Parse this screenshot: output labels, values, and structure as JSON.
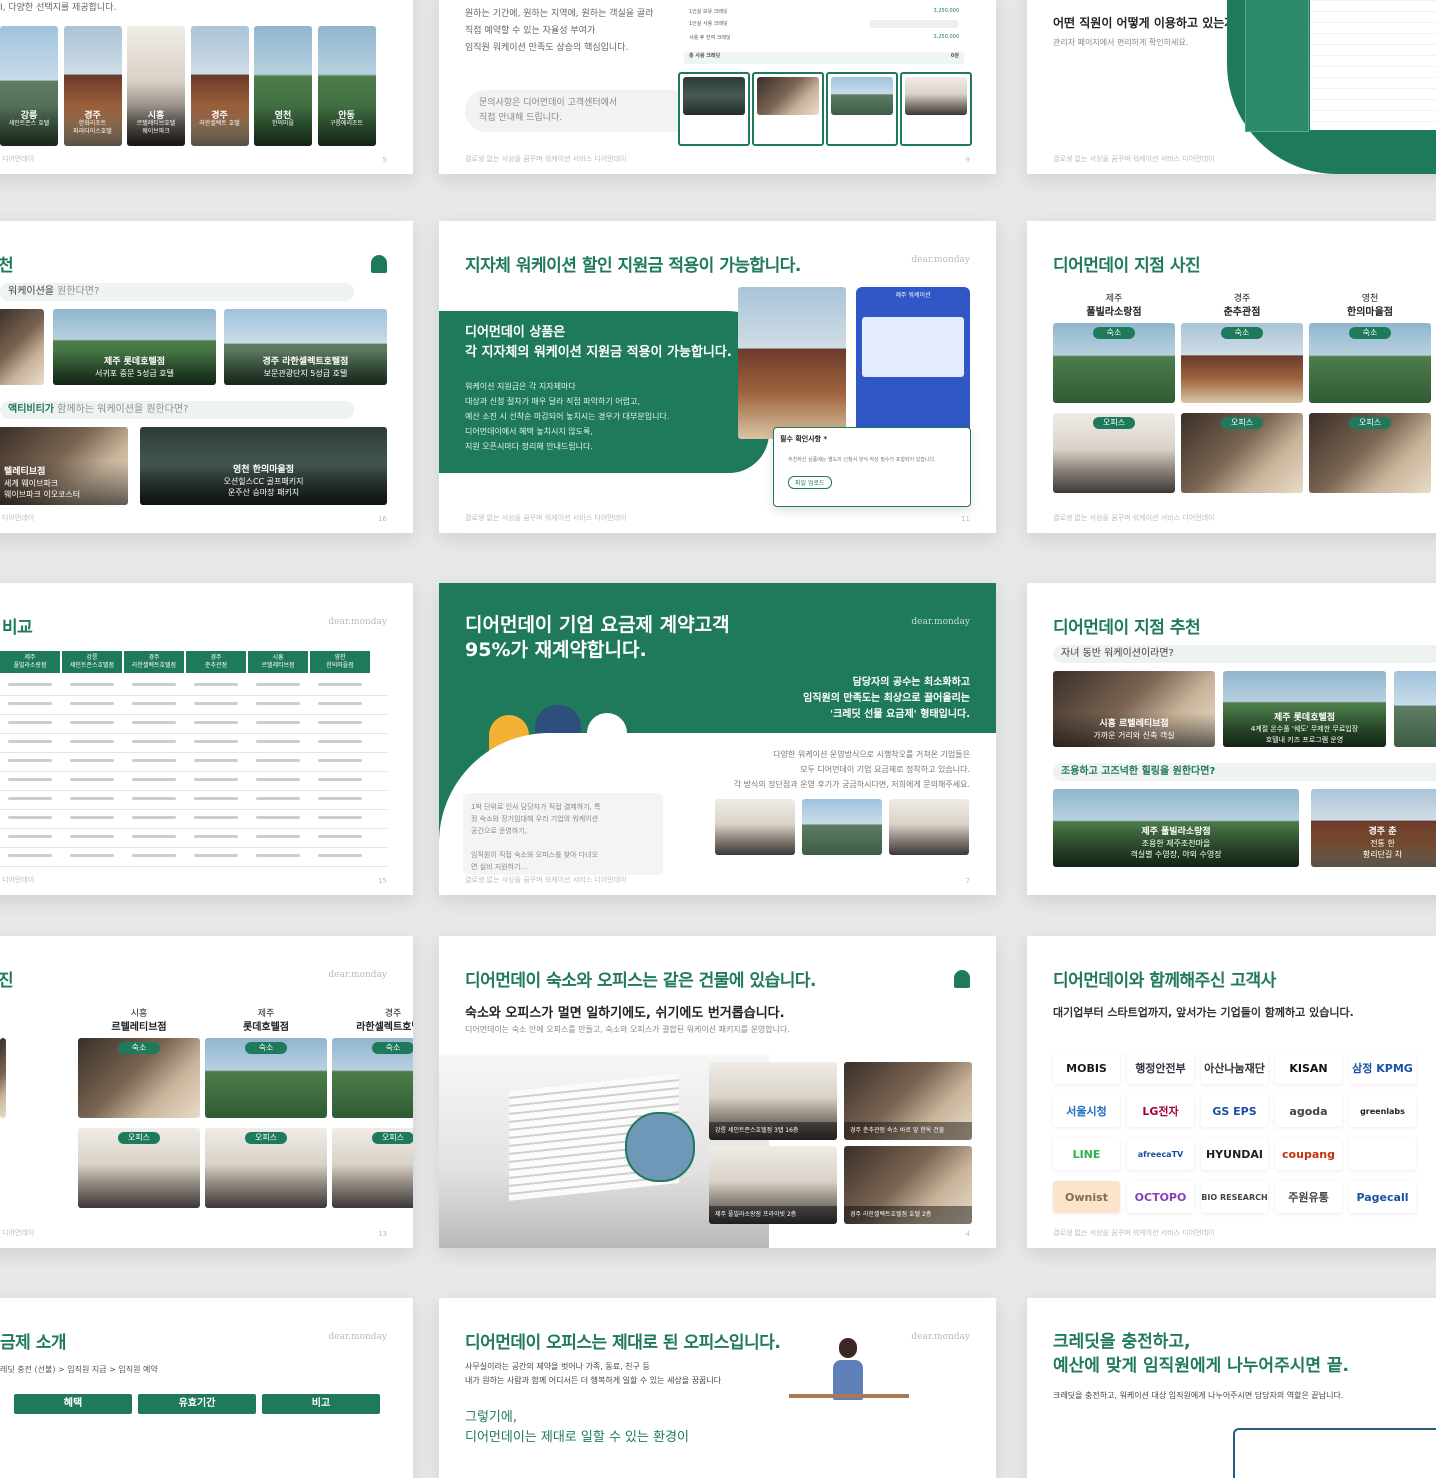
{
  "footer_text": "결로생 없는 서상을 꿈꾸며 워케이션 서비스 디어먼데이",
  "brand": "dear.monday",
  "s5": {
    "top_text": "I, 다양한 선택지를 제공합니다.",
    "cards": [
      {
        "name": "강릉",
        "sub": "세인트존스 호텔"
      },
      {
        "name": "경주",
        "sub": "한화리조트\n파라다이스호텔"
      },
      {
        "name": "시흥",
        "sub": "르텔레티브호텔\n웨이브파크"
      },
      {
        "name": "경주",
        "sub": "라한셀렉트 호텔"
      },
      {
        "name": "영천",
        "sub": "한의마을"
      },
      {
        "name": "안동",
        "sub": "구름에리조트"
      }
    ],
    "foot": "디어먼데이",
    "page": "5"
  },
  "s9": {
    "lines": [
      "원하는 기간에, 원하는 지역에, 원하는 객실을 골라",
      "직접 예약할 수 있는 자율성 부여가",
      "임직원 워케이션 만족도 상승의 핵심입니다."
    ],
    "pill": "문의사항은 디어먼데이 고객센터에서\n직접 안내해 드립니다.",
    "rows": [
      {
        "label": "1인실 보유 크레딧",
        "value": "3,250,000"
      },
      {
        "label": "1인실 사용 크레딧",
        "value": ""
      },
      {
        "label": "사용 후 잔여 크레딧",
        "value": "3,250,000"
      }
    ],
    "total_label": "총 사용 크레딧",
    "total_value": "0원",
    "page": "9"
  },
  "s_admin": {
    "lines": [
      "어떤 직원이 어떻게 이용하고 있는지,",
      "관리자 페이지에서 편리하게 확인하세요."
    ],
    "page_label": "결로생 없는 서상을 꿈꾸며 워케이션 서비스 디어먼데이"
  },
  "s16": {
    "title_fragment": "천",
    "q1_pre": "워케이션을",
    "q1_accent": " 원한다면?",
    "card_a": {
      "name": "제주 롯데호텔점",
      "sub": "서귀포 중문 5성급 호텔"
    },
    "card_b": {
      "name": "경주 라한셀렉트호텔점",
      "sub": "보문관광단지 5성급 호텔"
    },
    "q2_pre": "액티비티가",
    "q2_accent": " 함께하는 워케이션을 원한다면?",
    "card_c": {
      "name": "텔레티브점",
      "sub": "세계 웨이브파크\n웨이브파크 이오코스터"
    },
    "card_d": {
      "name": "영천 한의마을점",
      "sub": "오션힐스CC 골프패키지\n운주산 승마장 패키지"
    },
    "foot": "디어먼데이",
    "page": "16"
  },
  "s11": {
    "title": "지자체 워케이션 할인 지원금 적용이 가능합니다.",
    "box_title": "디어먼데이 상품은\n각 지자체의 워케이션 지원금 적용이 가능합니다.",
    "box_body": "워케이션 지원금은 각 지자체마다\n대상과 신청 절차가 매우 달라 직접 파악하기 어렵고,\n예산 소진 시 선착순 마감되어 놓치시는 경우가 대부분입니다.\n디어먼데이에서 혜택 놓치시지 않도록,\n지원 오픈시마다 정리해 안내드립니다.",
    "phone_header": "제주 워케이션",
    "dialog_title": "필수 확인사항 *",
    "dialog_body": "추천하신 상품에는 별도의 신청서 양식 작성 필수가 포함되어 있습니다.",
    "upload": "파일 업로드",
    "page": "11"
  },
  "s_photos": {
    "title": "디어먼데이 지점 사진",
    "cols": [
      {
        "region": "제주",
        "name": "풀빌라소랑점"
      },
      {
        "region": "경주",
        "name": "춘추관점"
      },
      {
        "region": "영천",
        "name": "한의마을점"
      }
    ],
    "lodging": "숙소",
    "office": "오피스"
  },
  "s15": {
    "title": "비교",
    "headers": [
      "제주\n풀빌라소랑점",
      "강릉\n세인트존스호텔점",
      "경주\n라한셀렉트호텔점",
      "경주\n춘추관점",
      "시흥\n르텔레티브점",
      "영천\n한의마을점"
    ],
    "foot": "디어먼데이",
    "page": "15"
  },
  "s7": {
    "title": "디어먼데이 기업 요금제 계약고객\n95%가 재계약합니다.",
    "right_text": "담당자의 공수는 최소화하고\n임직원의 만족도는 최상으로 끌어올리는\n'크레딧 선물 요금제' 형태입니다.",
    "desc": "다양한 워케이션 운영방식으로 시행착오를 거쳐온 기업들은\n모두 디어먼데이 기업 요금제로 정착하고 있습니다.\n각 방식의 장단점과 운영 후기가 궁금하시다면, 저희에게 문의해주세요.",
    "quote": "1박 단위로 인사 담당자가 직접 결제하기, 특\n정 숙소와 장기임대해 우리 기업의 워케이션\n공간으로 운영하기,\n\n임직원이 직접 숙소와 오피스를 찾아 다녀오\n면 실비 지원하기...",
    "page": "7"
  },
  "s_reco": {
    "title": "디어먼데이 지점 추천",
    "q1": "자녀 동반 워케이션이라면?",
    "card_a": {
      "name": "시흥 르텔레티브점",
      "sub": "가까운 거리와 신축 객실"
    },
    "card_b": {
      "name": "제주 롯데호텔점",
      "sub": "4계절 온수풀 '쉐도' 무제한 무료입장\n호텔내 키즈 프로그램 운영"
    },
    "q2": "조용하고 고즈넉한 힐링을 원한다면?",
    "card_c": {
      "name": "제주 풀빌라소랑점",
      "sub": "조용한 제주조천마을\n객실별 수영장, 야외 수영장"
    },
    "card_d": {
      "name": "경주 춘",
      "sub": "전통 한\n황리단길 차"
    }
  },
  "s13": {
    "title": "진",
    "cols": [
      {
        "region": "시흥",
        "name": "르텔레티브점"
      },
      {
        "region": "제주",
        "name": "롯데호텔점"
      },
      {
        "region": "경주",
        "name": "라한셀렉트호텔점"
      }
    ],
    "lodging": "숙소",
    "office": "오피스",
    "foot": "디어먼데이",
    "page": "13"
  },
  "s4": {
    "title": "디어먼데이 숙소와 오피스는 같은 건물에 있습니다.",
    "subtitle": "숙소와 오피스가 멀면 일하기에도, 쉬기에도 번거롭습니다.",
    "desc": "디어먼데이는 숙소 안에 오피스를 만들고, 숙소와 오피스가 결합된 워케이션 패키지를 운영합니다.",
    "tiles": [
      "강릉 세인트존스호텔점 3탭 16층",
      "경주 춘추관점 숙소 바로 앞 한옥 건물",
      "제주 풀빌라소랑점 프라이빗 2층",
      "경주 라한셀렉트호텔점 호텔 2층"
    ],
    "page": "4"
  },
  "s_clients": {
    "title": "디어먼데이와 함께해주신 고객사",
    "subtitle": "대기업부터 스타트업까지, 앞서가는 기업들이 함께하고 있습니다.",
    "logos": [
      "MOBIS",
      "행정안전부",
      "아산나눔재단",
      "KISAN",
      "삼정 KPMG",
      "서울시청",
      "LG전자",
      "GS EPS",
      "agoda",
      "greenlabs",
      "LINE",
      "afreecaTV",
      "HYUNDAI",
      "coupang",
      "",
      "Ownist",
      "OCTOPO",
      "BIO RESEARCH",
      "주원유통",
      "Pagecall"
    ]
  },
  "s_plan": {
    "title": "금제 소개",
    "path": "레딧 충전 (선불) > 임직원 지급 > 임직원 예약",
    "cols": [
      "혜택",
      "유효기간",
      "비고"
    ]
  },
  "s_office": {
    "title": "디어먼데이 오피스는 제대로 된 오피스입니다.",
    "lines": "사무실이라는 공간의 제약을 벗어나 가족, 동료, 친구 등\n내가 원하는 사람과 함께 어디서든 더 행복하게 일할 수 있는 세상을 꿈꿉니다",
    "tail": "그렇기에,\n디어먼데이는 제대로 일할 수 있는 환경이"
  },
  "s_credit": {
    "title": "크레딧을 충전하고,\n예산에 맞게 임직원에게 나누어주시면 끝.",
    "subtitle": "크레딧을 충전하고, 워케이션 대상 임직원에게 나누어주시면 담당자의 역할은 끝납니다."
  }
}
